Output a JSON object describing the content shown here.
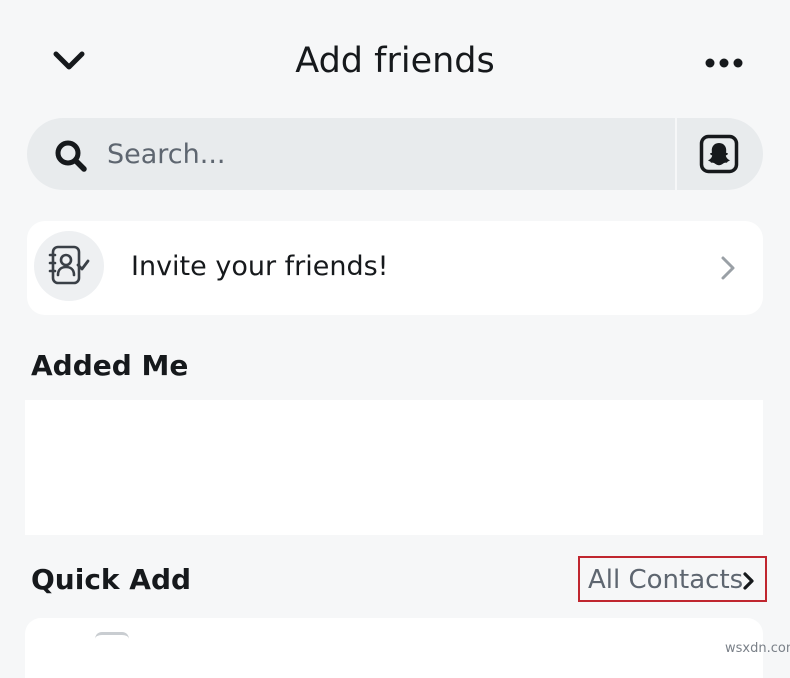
{
  "header": {
    "title": "Add friends",
    "back_icon": "chevron-down-icon",
    "more_icon": "more-horizontal-icon"
  },
  "search": {
    "placeholder": "Search...",
    "value": "",
    "search_icon": "search-icon",
    "snapcode_icon": "snapcode-icon"
  },
  "invite": {
    "label": "Invite your friends!",
    "icon": "contacts-check-icon",
    "chevron_icon": "chevron-right-icon"
  },
  "added_me": {
    "title": "Added Me"
  },
  "quick_add": {
    "title": "Quick Add",
    "all_contacts_label": "All Contacts",
    "all_contacts_icon": "chevron-right-icon"
  },
  "watermark": "wsxdn.com",
  "colors": {
    "background": "#F6F7F8",
    "search_bg": "#E8EBED",
    "card_bg": "#FFFFFF",
    "text_primary": "#16191C",
    "text_secondary": "#5E6670",
    "highlight_border": "#C0262F"
  }
}
